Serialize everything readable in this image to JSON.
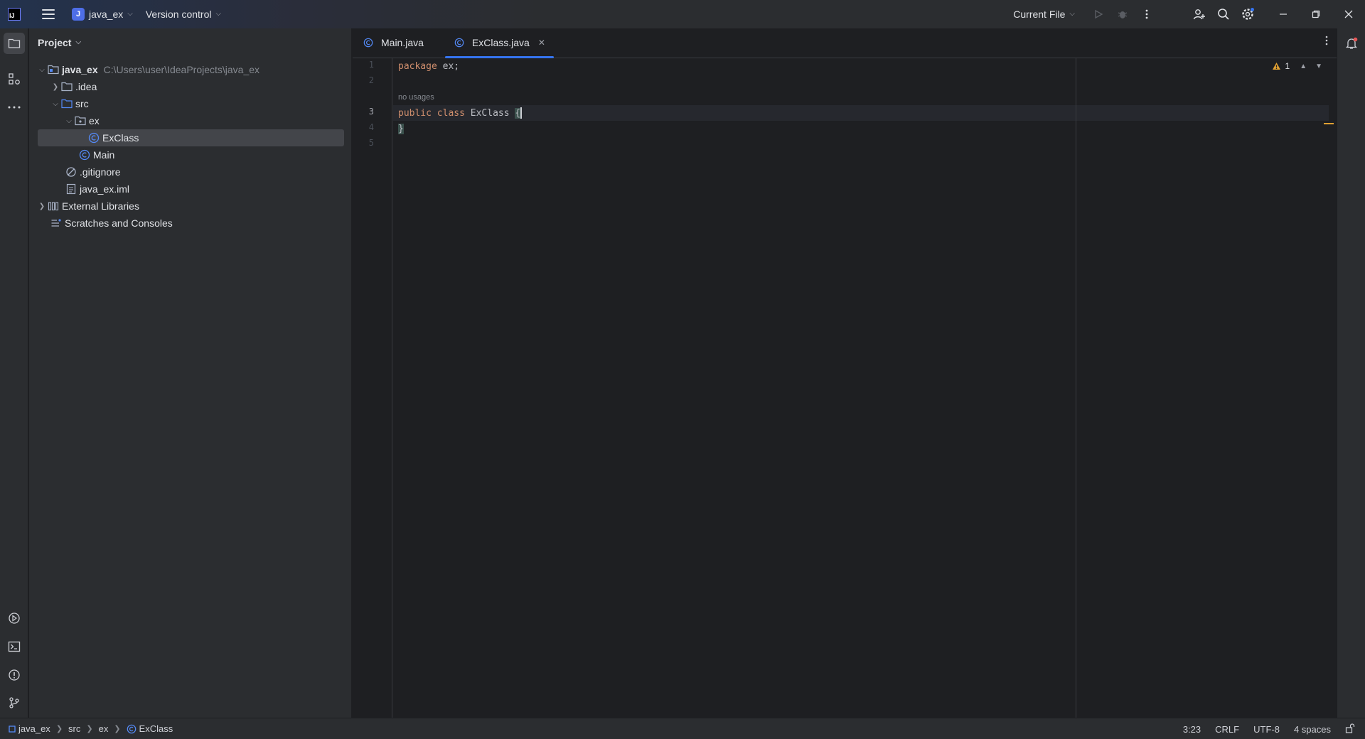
{
  "titlebar": {
    "app_logo": "IJ",
    "project_badge": "J",
    "project_name": "java_ex",
    "vcs_label": "Version control",
    "run_config": "Current File"
  },
  "project_panel": {
    "title": "Project",
    "tree": [
      {
        "label": "java_ex",
        "hint": "C:\\Users\\user\\IdeaProjects\\java_ex"
      },
      {
        "label": ".idea"
      },
      {
        "label": "src"
      },
      {
        "label": "ex"
      },
      {
        "label": "ExClass"
      },
      {
        "label": "Main"
      },
      {
        "label": ".gitignore"
      },
      {
        "label": "java_ex.iml"
      },
      {
        "label": "External Libraries"
      },
      {
        "label": "Scratches and Consoles"
      }
    ]
  },
  "editor": {
    "tabs": [
      {
        "label": "Main.java"
      },
      {
        "label": "ExClass.java"
      }
    ],
    "line_numbers": [
      "1",
      "2",
      "3",
      "4",
      "5"
    ],
    "code": {
      "line1_kw": "package",
      "line1_rest": " ex;",
      "inlay_hint": "no usages",
      "line3_kw1": "public",
      "line3_kw2": "class",
      "line3_cls": "ExClass",
      "line3_brace": "{",
      "line4_brace": "}"
    },
    "warning_count": "1"
  },
  "statusbar": {
    "breadcrumbs": [
      "java_ex",
      "src",
      "ex",
      "ExClass"
    ],
    "position": "3:23",
    "line_separator": "CRLF",
    "encoding": "UTF-8",
    "indent": "4 spaces"
  },
  "colors": {
    "accent": "#3574f0",
    "keyword": "#cf8e6d",
    "class_icon": "#548af7",
    "warning": "#e0a032"
  }
}
